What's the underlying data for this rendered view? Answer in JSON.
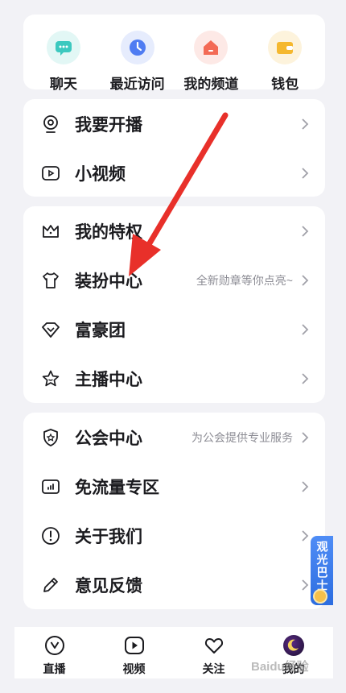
{
  "quick_actions": [
    {
      "label": "聊天",
      "icon": "chat-icon",
      "bg": "#e2f7f5",
      "color": "#3cc9bf"
    },
    {
      "label": "最近访问",
      "icon": "clock-icon",
      "bg": "#e6ecfd",
      "color": "#4f7cf2"
    },
    {
      "label": "我的频道",
      "icon": "home-icon",
      "bg": "#fde9e6",
      "color": "#f36a55"
    },
    {
      "label": "钱包",
      "icon": "wallet-icon",
      "bg": "#fdf3dc",
      "color": "#f5b82e"
    }
  ],
  "menu_group_1": [
    {
      "label": "我要开播",
      "icon": "camera-icon"
    },
    {
      "label": "小视频",
      "icon": "video-icon"
    }
  ],
  "menu_group_2": [
    {
      "label": "我的特权",
      "icon": "crown-icon"
    },
    {
      "label": "装扮中心",
      "sub": "全新勋章等你点亮~",
      "icon": "shirt-icon"
    },
    {
      "label": "富豪团",
      "icon": "diamond-icon"
    },
    {
      "label": "主播中心",
      "icon": "star-icon"
    }
  ],
  "menu_group_3": [
    {
      "label": "公会中心",
      "sub": "为公会提供专业服务",
      "icon": "shield-icon"
    },
    {
      "label": "免流量专区",
      "icon": "signal-icon"
    },
    {
      "label": "关于我们",
      "icon": "info-icon"
    },
    {
      "label": "意见反馈",
      "icon": "pencil-icon"
    }
  ],
  "bottom_tabs": [
    {
      "label": "直播",
      "icon": "live-icon"
    },
    {
      "label": "视频",
      "icon": "play-icon"
    },
    {
      "label": "关注",
      "icon": "heart-icon"
    },
    {
      "label": "我的",
      "icon": "avatar-icon"
    }
  ],
  "float_widget": {
    "text": "观光巴士"
  },
  "watermark": "Baidu经验",
  "colors": {
    "background": "#f2f2f6",
    "card": "#ffffff",
    "text": "#1b1b1f",
    "subtext": "#8c8c94",
    "arrow": "#e8302a"
  }
}
